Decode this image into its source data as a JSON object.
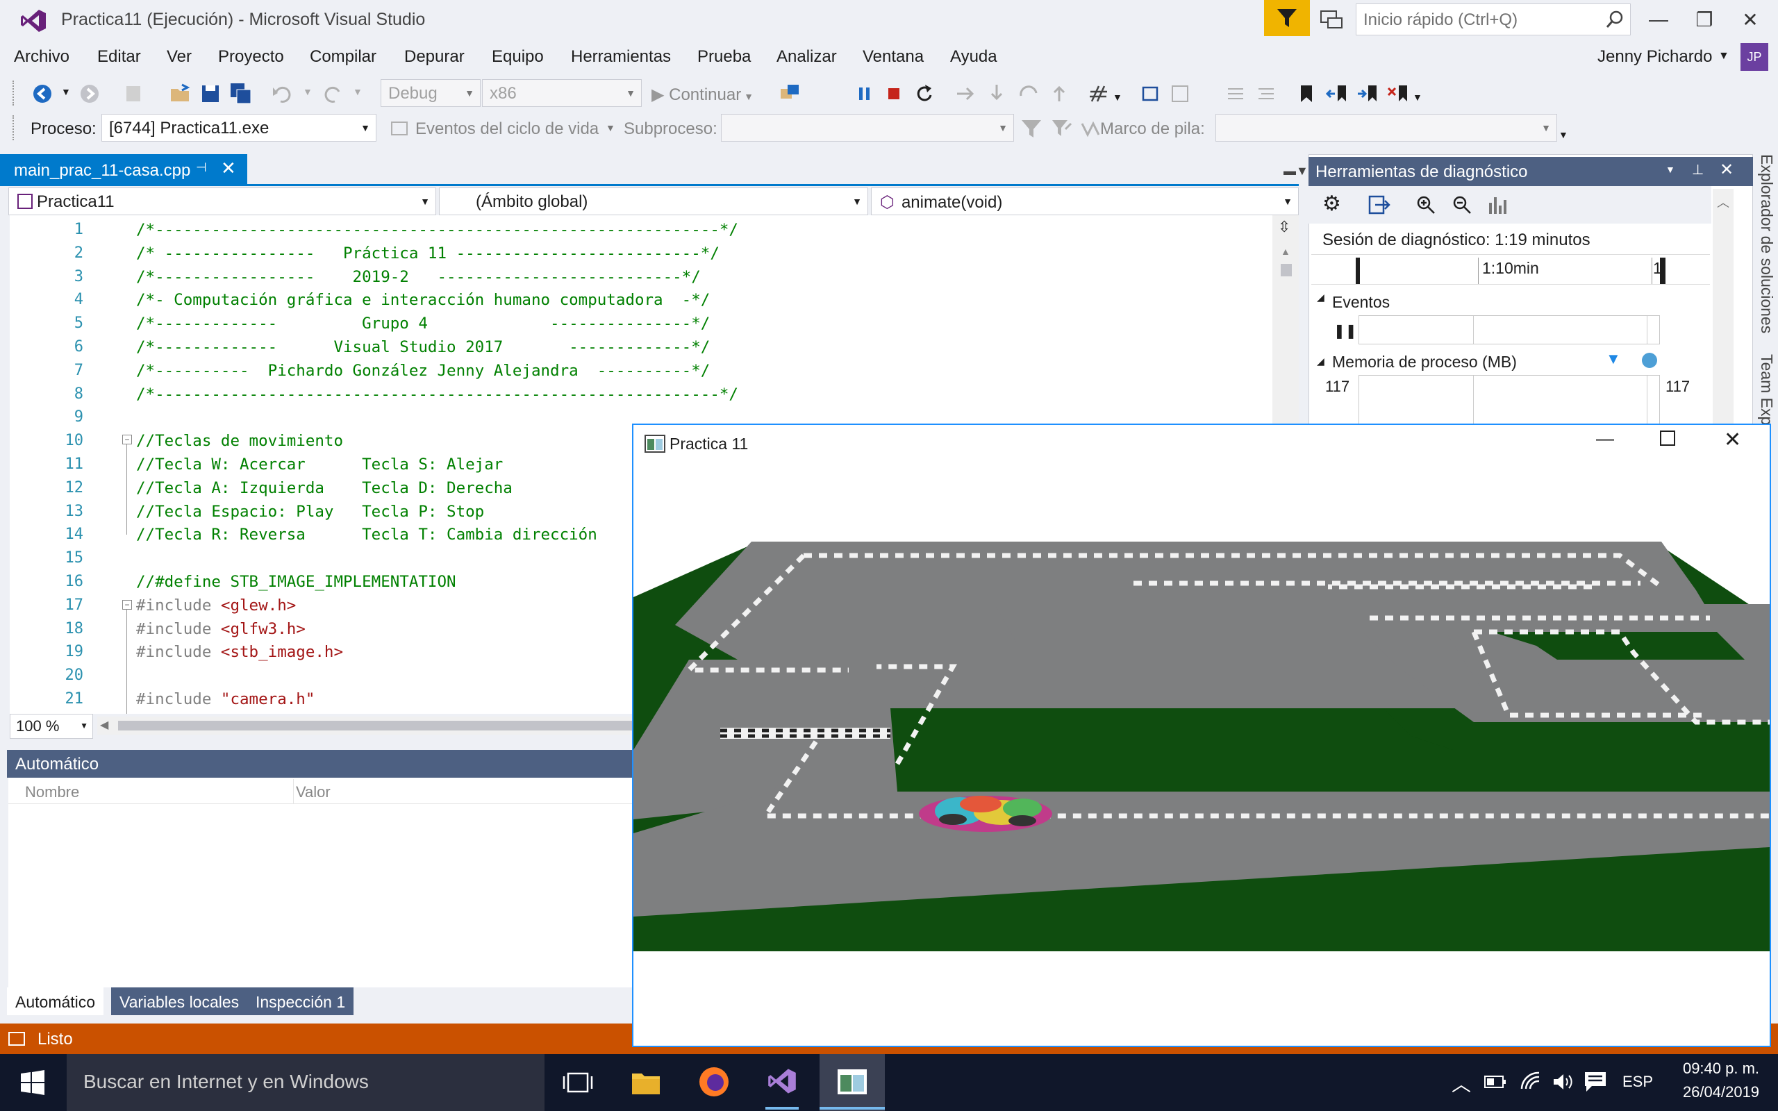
{
  "window": {
    "title": "Practica11 (Ejecución) - Microsoft Visual Studio",
    "quick_launch_placeholder": "Inicio rápido (Ctrl+Q)",
    "minimize": "—",
    "restore": "❐",
    "close": "✕"
  },
  "menu": {
    "items": [
      "Archivo",
      "Editar",
      "Ver",
      "Proyecto",
      "Compilar",
      "Depurar",
      "Equipo",
      "Herramientas",
      "Prueba",
      "Analizar",
      "Ventana",
      "Ayuda"
    ],
    "user": "Jenny Pichardo",
    "avatar": "JP"
  },
  "toolbar": {
    "config": "Debug",
    "platform": "x86",
    "continue_label": "Continuar",
    "process_label": "Proceso:",
    "process_value": "[6744] Practica11.exe",
    "lifecycle_label": "Eventos del ciclo de vida",
    "thread_label": "Subproceso:",
    "stack_label": "Marco de pila:"
  },
  "editor": {
    "tab_name": "main_prac_11-casa.cpp",
    "project_combo": "Practica11",
    "scope_combo": "(Ámbito global)",
    "member_combo": "animate(void)",
    "zoom": "100 %",
    "lines": [
      {
        "n": "1",
        "t": "/*------------------------------------------------------------*/"
      },
      {
        "n": "2",
        "t": "/* ----------------   Práctica 11 --------------------------*/"
      },
      {
        "n": "3",
        "t": "/*-----------------    2019-2   --------------------------*/"
      },
      {
        "n": "4",
        "t": "/*- Computación gráfica e interacción humano computadora  -*/"
      },
      {
        "n": "5",
        "t": "/*-------------         Grupo 4             ---------------*/"
      },
      {
        "n": "6",
        "t": "/*-------------      Visual Studio 2017       -------------*/"
      },
      {
        "n": "7",
        "t": "/*----------  Pichardo González Jenny Alejandra  ----------*/"
      },
      {
        "n": "8",
        "t": "/*------------------------------------------------------------*/"
      },
      {
        "n": "9",
        "t": ""
      },
      {
        "n": "10",
        "t": "//Teclas de movimiento"
      },
      {
        "n": "11",
        "t": "//Tecla W: Acercar      Tecla S: Alejar"
      },
      {
        "n": "12",
        "t": "//Tecla A: Izquierda    Tecla D: Derecha"
      },
      {
        "n": "13",
        "t": "//Tecla Espacio: Play   Tecla P: Stop"
      },
      {
        "n": "14",
        "t": "//Tecla R: Reversa      Tecla T: Cambia dirección"
      },
      {
        "n": "15",
        "t": ""
      },
      {
        "n": "16",
        "t": "//#define STB_IMAGE_IMPLEMENTATION"
      },
      {
        "n": "17",
        "t": "#include <glew.h>"
      },
      {
        "n": "18",
        "t": "#include <glfw3.h>"
      },
      {
        "n": "19",
        "t": "#include <stb_image.h>"
      },
      {
        "n": "20",
        "t": ""
      },
      {
        "n": "21",
        "t": "#include \"camera.h\""
      }
    ]
  },
  "autos": {
    "title": "Automático",
    "col_name": "Nombre",
    "col_value": "Valor",
    "tabs": [
      "Automático",
      "Variables locales",
      "Inspección 1"
    ]
  },
  "status": {
    "text": "Listo"
  },
  "diagnostics": {
    "title": "Herramientas de diagnóstico",
    "session": "Sesión de diagnóstico: 1:19 minutos",
    "timeline_label": "1:10min",
    "timeline_end": "1",
    "events_label": "Eventos",
    "memory_label": "Memoria de proceso (MB)",
    "memory_left": "117",
    "memory_right": "117"
  },
  "side_tabs": {
    "solution": "Explorador de soluciones",
    "team": "Team Exp"
  },
  "game": {
    "title": "Practica 11"
  },
  "taskbar": {
    "search_placeholder": "Buscar en Internet y en Windows",
    "lang": "ESP",
    "time": "09:40 p. m.",
    "date": "26/04/2019"
  }
}
